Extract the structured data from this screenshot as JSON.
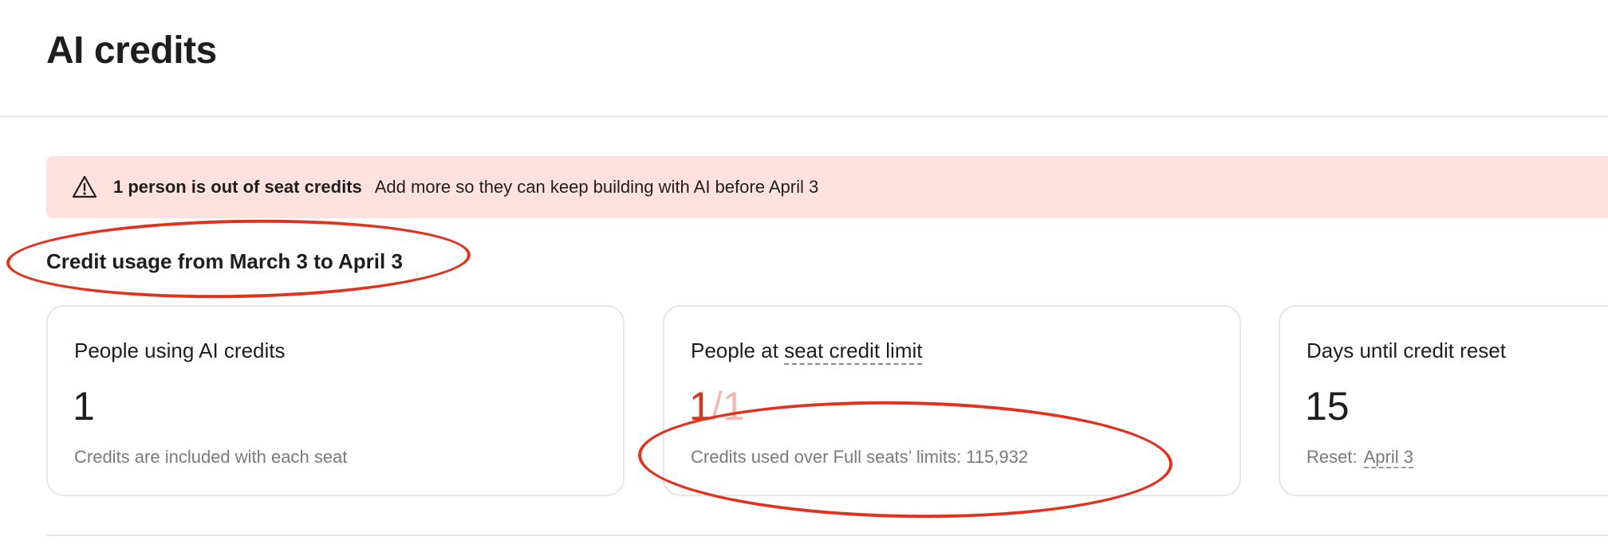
{
  "page": {
    "title": "AI credits"
  },
  "alert": {
    "icon": "warning-icon",
    "title": "1 person is out of seat credits",
    "message": "Add more so they can keep building with AI before April 3",
    "background_color": "#ffe2e0"
  },
  "usage": {
    "heading": "Credit usage from March 3 to April 3",
    "cards": [
      {
        "title": "People using AI credits",
        "value": "1",
        "caption": "Credits are included with each seat"
      },
      {
        "title_prefix": "People at ",
        "title_link": "seat credit limit",
        "value_used": "1",
        "value_separator": "/",
        "value_total": "1",
        "caption": "Credits used over Full seats’ limits: 115,932"
      },
      {
        "title": "Days until credit reset",
        "value": "15",
        "caption_label": "Reset:",
        "caption_date": "April 3"
      }
    ]
  },
  "colors": {
    "limit_used": "#d2371f",
    "limit_total": "#f5b8ae",
    "annotation": "#e2311d"
  }
}
